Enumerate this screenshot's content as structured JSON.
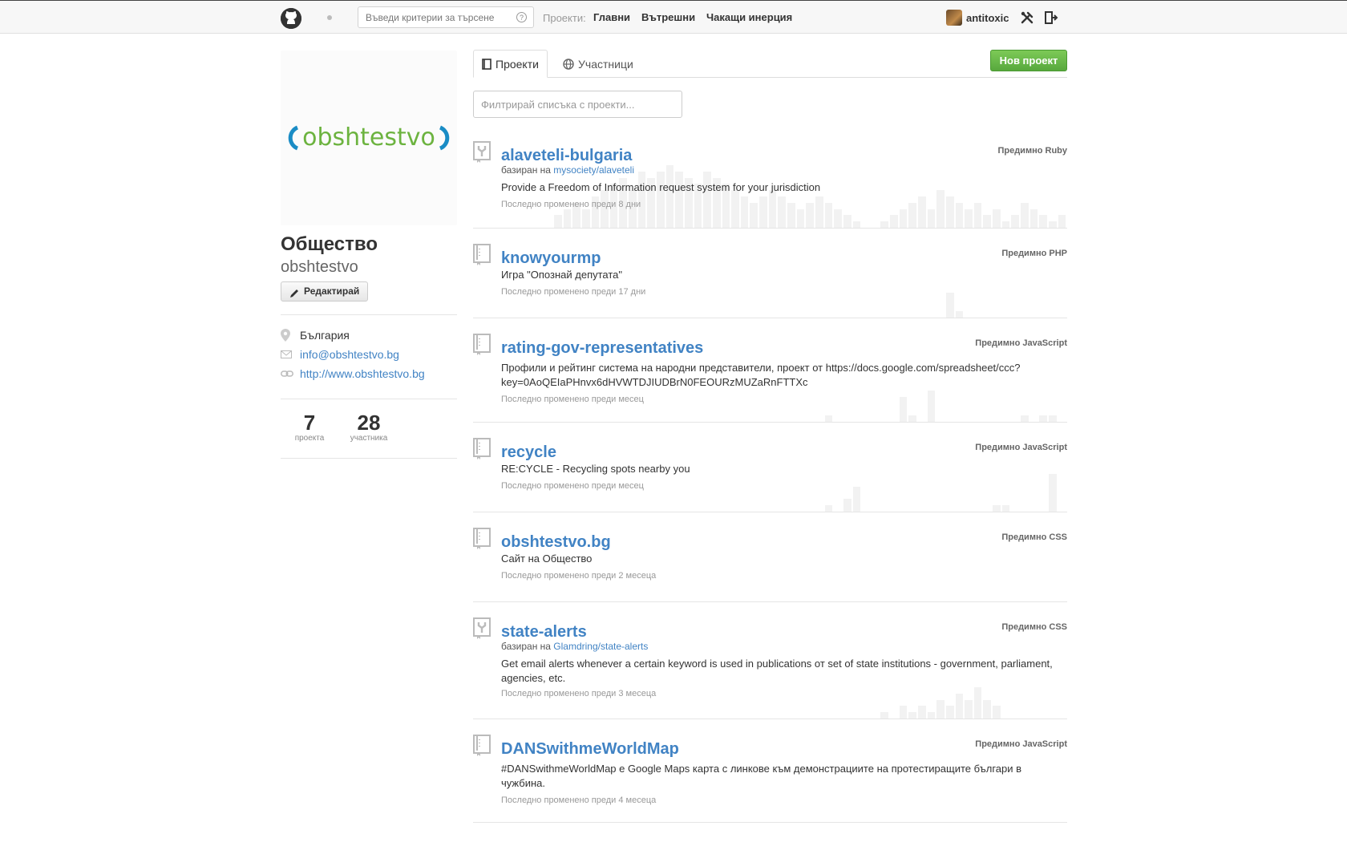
{
  "header": {
    "search_placeholder": "Въведи критерии за търсене",
    "help_glyph": "?",
    "nav_label": "Проекти:",
    "nav_links": [
      "Главни",
      "Вътрешни",
      "Чакащи инерция"
    ],
    "username": "antitoxic"
  },
  "sidebar": {
    "org_name": "Общество",
    "org_login": "obshtestvo",
    "logo_text": "obshtestvo",
    "edit_label": "Редактирай",
    "location": "България",
    "email": "info@obshtestvo.bg",
    "website": "http://www.obshtestvo.bg",
    "stats": [
      {
        "value": "7",
        "label": "проекта"
      },
      {
        "value": "28",
        "label": "участника"
      }
    ]
  },
  "tabs": [
    {
      "label": "Проекти",
      "active": true
    },
    {
      "label": "Участници",
      "active": false
    }
  ],
  "new_button": "Нов проект",
  "filter_placeholder": "Филтрирай списъка с проекти...",
  "repos": [
    {
      "name": "alaveteli-bulgaria",
      "language": "Предимно Ruby",
      "forked": true,
      "fork_prefix": "базиран на",
      "fork_source": "mysociety/alaveteli",
      "description": "Provide a Freedom of Information request system for your jurisdiction",
      "updated": "Последно променено преди 8 дни",
      "activity": [
        2,
        3,
        4,
        3,
        5,
        6,
        7,
        8,
        6,
        9,
        8,
        9,
        10,
        9,
        8,
        7,
        9,
        8,
        7,
        6,
        5,
        4,
        5,
        6,
        5,
        4,
        3,
        4,
        5,
        4,
        3,
        2,
        1,
        0,
        0,
        1,
        2,
        3,
        4,
        5,
        3,
        6,
        5,
        4,
        3,
        4,
        2,
        3,
        1,
        2,
        4,
        3,
        2,
        1,
        2
      ]
    },
    {
      "name": "knowyourmp",
      "language": "Предимно PHP",
      "forked": false,
      "description": "Игра \"Опознай депутата\"",
      "updated": "Последно променено преди 17 дни",
      "activity": [
        0,
        0,
        0,
        0,
        0,
        0,
        0,
        0,
        0,
        0,
        0,
        0,
        0,
        0,
        0,
        0,
        0,
        0,
        0,
        0,
        0,
        0,
        0,
        0,
        0,
        0,
        0,
        0,
        0,
        0,
        0,
        0,
        0,
        0,
        0,
        0,
        0,
        0,
        0,
        0,
        0,
        0,
        4,
        1,
        0,
        0,
        0,
        0,
        0,
        0,
        0,
        0,
        0,
        0,
        0
      ]
    },
    {
      "name": "rating-gov-representatives",
      "language": "Предимно JavaScript",
      "forked": false,
      "description": "Профили и рейтинг система на народни представители, проект от https://docs.google.com/spreadsheet/ccc?key=0AoQEIaPHnvx6dHVWTDJIUDBrN0FEOURzMUZaRnFTTXc",
      "updated": "Последно променено преди месец",
      "activity": [
        0,
        0,
        0,
        0,
        0,
        0,
        0,
        0,
        0,
        0,
        0,
        0,
        0,
        0,
        0,
        0,
        0,
        0,
        0,
        0,
        0,
        0,
        0,
        0,
        0,
        0,
        0,
        0,
        0,
        1,
        0,
        0,
        0,
        0,
        0,
        0,
        0,
        4,
        1,
        0,
        5,
        0,
        0,
        0,
        0,
        0,
        0,
        0,
        0,
        0,
        1,
        0,
        1,
        1,
        0
      ]
    },
    {
      "name": "recycle",
      "language": "Предимно JavaScript",
      "forked": false,
      "description": "RE:CYCLE - Recycling spots nearby you",
      "updated": "Последно променено преди месец",
      "activity": [
        0,
        0,
        0,
        0,
        0,
        0,
        0,
        0,
        0,
        0,
        0,
        0,
        0,
        0,
        0,
        0,
        0,
        0,
        0,
        0,
        0,
        0,
        0,
        0,
        0,
        0,
        0,
        0,
        0,
        1,
        0,
        2,
        4,
        0,
        0,
        0,
        0,
        0,
        0,
        0,
        0,
        0,
        0,
        0,
        0,
        0,
        0,
        1,
        1,
        0,
        0,
        0,
        0,
        6,
        0
      ]
    },
    {
      "name": "obshtestvo.bg",
      "language": "Предимно CSS",
      "forked": false,
      "description": "Сайт на Общество",
      "updated": "Последно променено преди 2 месеца",
      "activity": []
    },
    {
      "name": "state-alerts",
      "language": "Предимно CSS",
      "forked": true,
      "fork_prefix": "базиран на",
      "fork_source": "Glamdring/state-alerts",
      "description": "Get email alerts whenever a certain keyword is used in publications от set of state institutions - government, parliament, agencies, etc.",
      "updated": "Последно променено преди 3 месеца",
      "activity": [
        0,
        0,
        0,
        0,
        0,
        0,
        0,
        0,
        0,
        0,
        0,
        0,
        0,
        0,
        0,
        0,
        0,
        0,
        0,
        0,
        0,
        0,
        0,
        0,
        0,
        0,
        0,
        0,
        0,
        0,
        0,
        0,
        0,
        0,
        0,
        1,
        0,
        2,
        1,
        2,
        1,
        3,
        2,
        4,
        3,
        5,
        3,
        2,
        0,
        0,
        0,
        0,
        0,
        0,
        0
      ]
    },
    {
      "name": "DANSwithmeWorldMap",
      "language": "Предимно JavaScript",
      "forked": false,
      "description": "#DANSwithmeWorldMap е Google Maps карта с линкове към демонстрациите на протестиращите българи в чужбина.",
      "updated": "Последно променено преди 4 месеца",
      "activity": []
    }
  ]
}
